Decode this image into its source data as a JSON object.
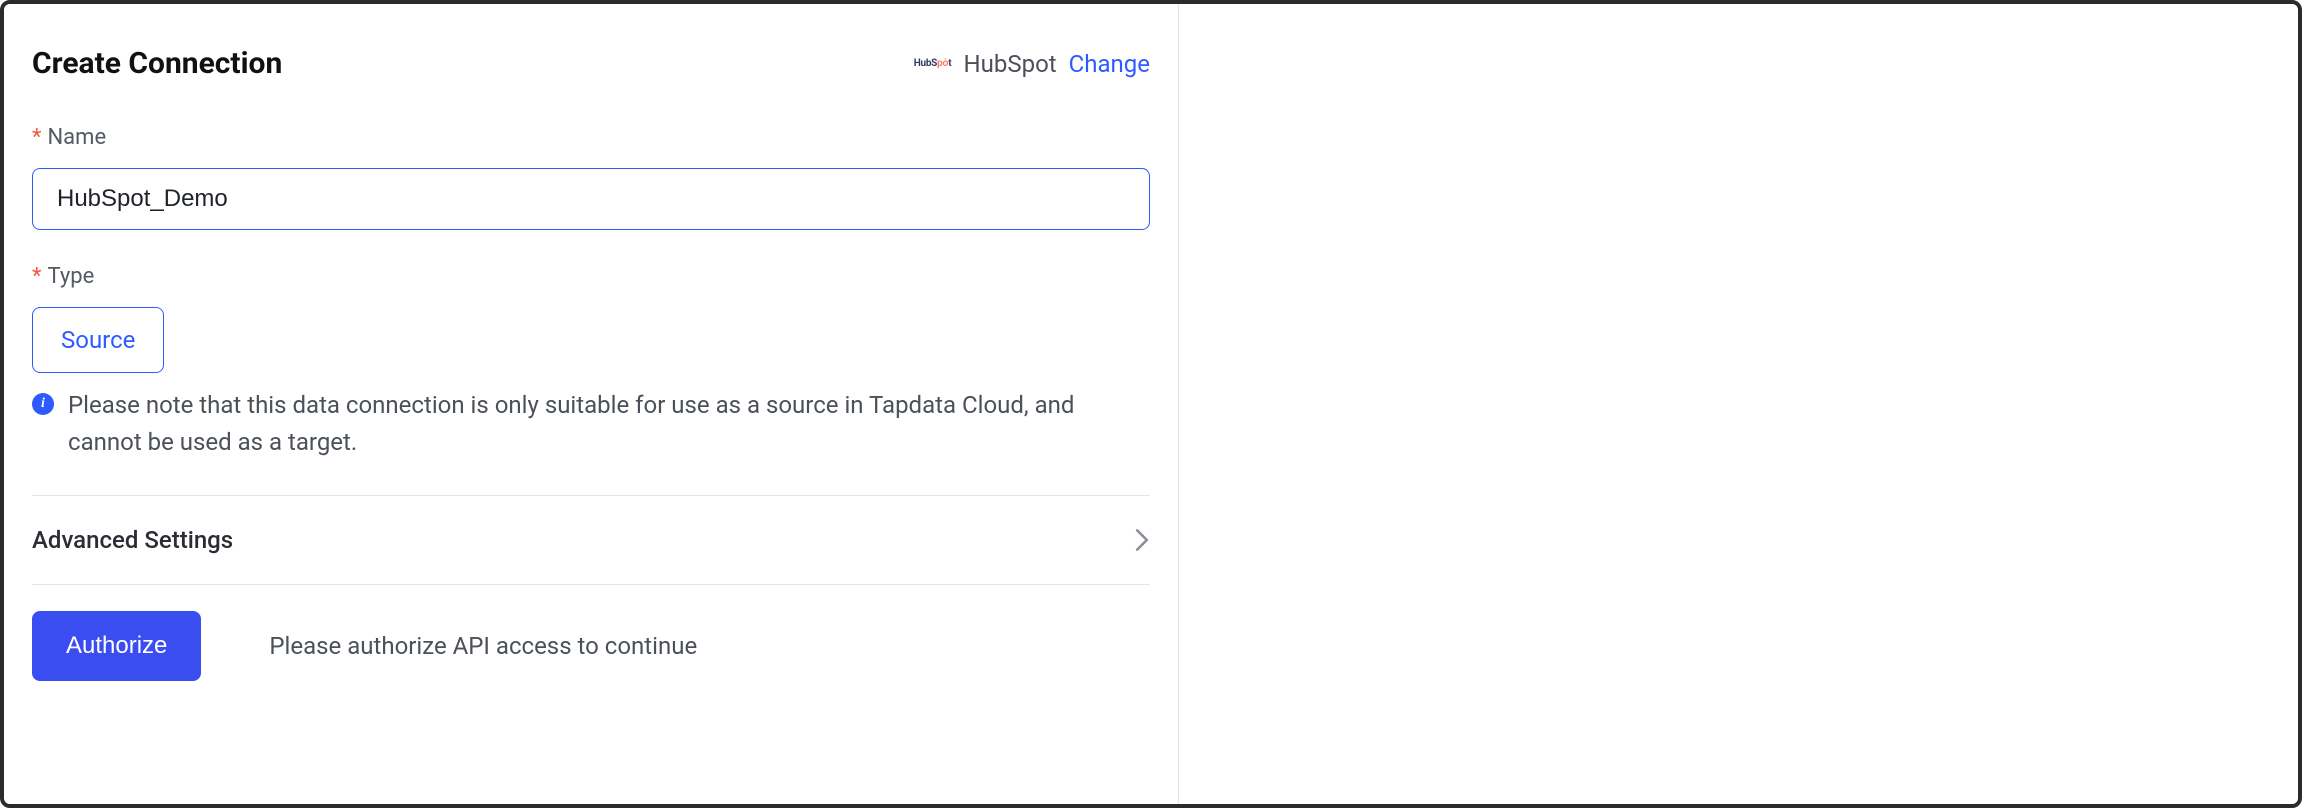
{
  "header": {
    "title": "Create Connection",
    "brand_name": "HubSpot",
    "change_label": "Change"
  },
  "fields": {
    "name": {
      "label": "Name",
      "value": "HubSpot_Demo"
    },
    "type": {
      "label": "Type",
      "selected": "Source",
      "note": "Please note that this data connection is only suitable for use as a source in Tapdata Cloud, and cannot be used as a target."
    }
  },
  "advanced": {
    "label": "Advanced Settings"
  },
  "authorize": {
    "button_label": "Authorize",
    "hint": "Please authorize API access to continue"
  },
  "logo_text_parts": {
    "pre": "HubS",
    "mid": "pȯ",
    "post": "t"
  }
}
